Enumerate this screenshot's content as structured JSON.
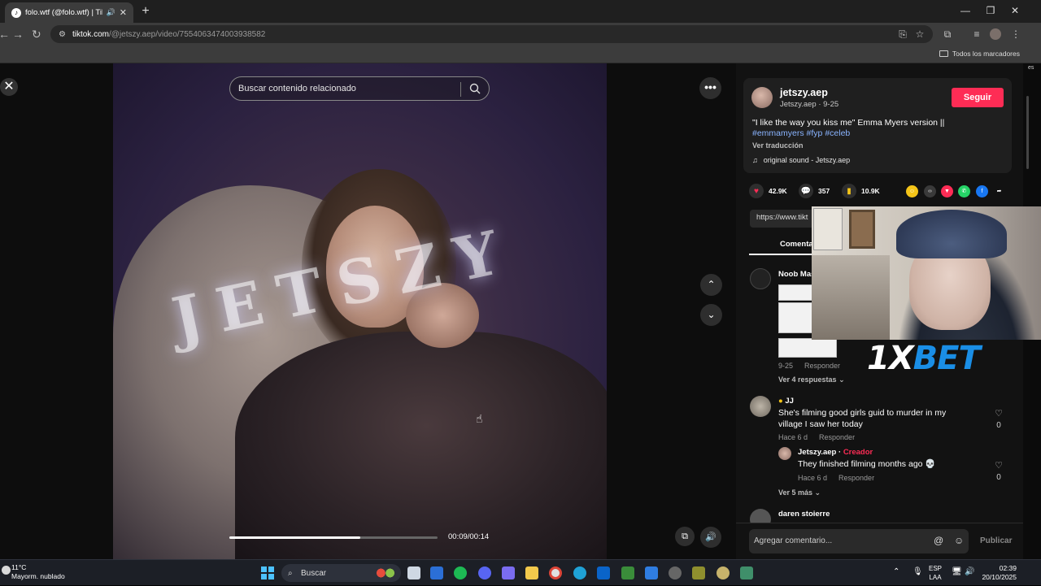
{
  "browser": {
    "tab_title": "folo.wtf (@folo.wtf) | TikTok",
    "tab_close": "✕",
    "new_tab": "+",
    "url_host": "tiktok.com",
    "url_path": "/@jetszy.aep/video/7554063474003938582",
    "bookmarks_folder": "Todos los marcadores"
  },
  "video": {
    "search_placeholder": "Buscar contenido relacionado",
    "watermark": "JETSZY",
    "time": "00:09/00:14",
    "progress": 0.63
  },
  "post": {
    "author": "jetszy.aep",
    "author_sub": "Jetszy.aep · 9-25",
    "follow_label": "Seguir",
    "description": "\"I like the way you kiss me\" Emma Myers version ||",
    "tags": [
      "#emmamyers",
      "#fyp",
      "#celeb"
    ],
    "translate": "Ver traducción",
    "sound": "original sound - Jetszy.aep",
    "likes": "42.9K",
    "comments": "357",
    "saves": "10.9K",
    "link": "https://www.tikt",
    "comments_tab": "Comenta"
  },
  "comments": [
    {
      "name": "Noob Mas",
      "date": "9-25",
      "reply": "Responder",
      "more": "Ver 4 respuestas"
    },
    {
      "name": "JJ",
      "text": "She's filming good girls guid to murder in my village I saw her today",
      "date": "Hace 6 d",
      "reply": "Responder",
      "likes": "0",
      "reply_item": {
        "name": "Jetszy.aep",
        "creator": "Creador",
        "text": "They finished filming months ago 💀",
        "date": "Hace 6 d",
        "reply": "Responder",
        "likes": "0"
      },
      "more": "Ver 5 más"
    },
    {
      "name": "daren stoierre"
    }
  ],
  "comment_bar": {
    "placeholder": "Agregar comentario...",
    "publish": "Publicar"
  },
  "overlay": {
    "bet_logo_a": "1X",
    "bet_logo_b": "BET"
  },
  "taskbar": {
    "temp": "11°C",
    "weather": "Mayorm. nublado",
    "search": "Buscar",
    "lang_a": "ESP",
    "lang_b": "LAA",
    "time": "02:39",
    "date": "20/10/2025"
  },
  "side_label": "es"
}
